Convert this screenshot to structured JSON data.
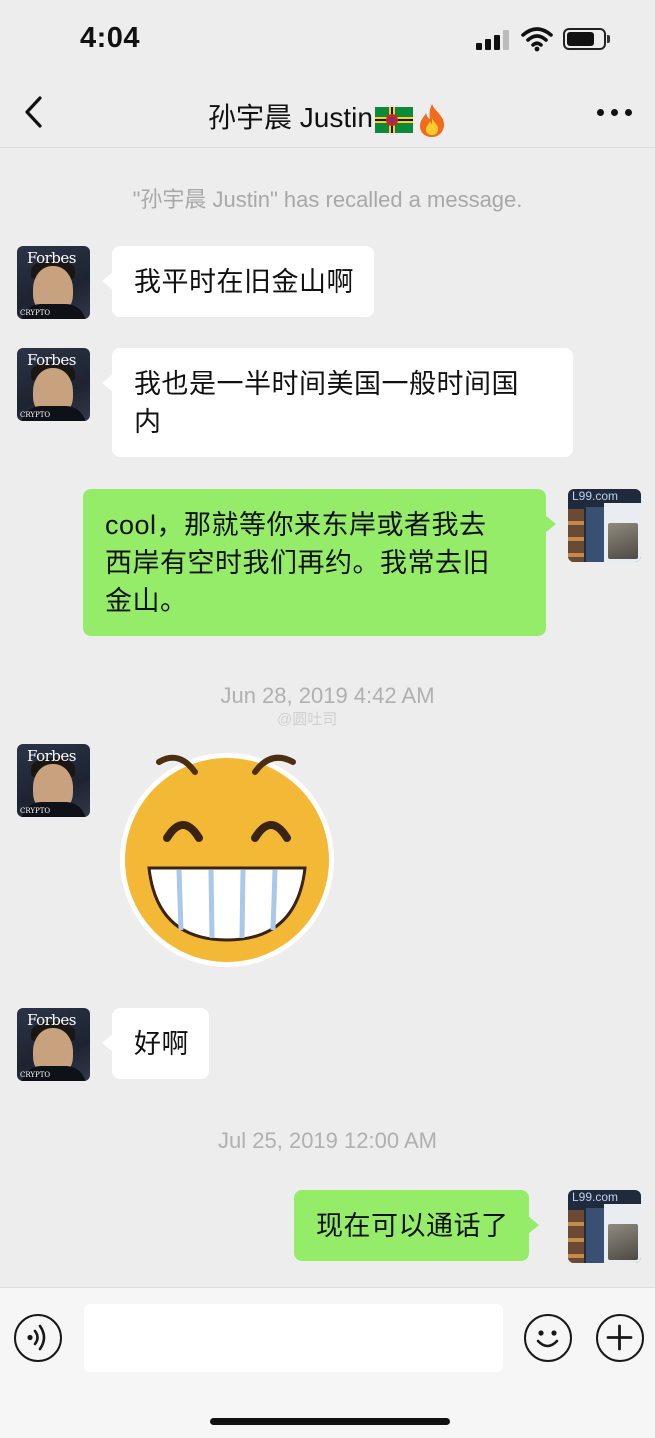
{
  "status_bar": {
    "time": "4:04"
  },
  "nav": {
    "title": "孙宇晨 Justin",
    "flag_icon": "dominica-flag-icon",
    "fire_icon": "fire-emoji-icon"
  },
  "system": {
    "recalled": "\"孙宇晨 Justin\" has recalled a message."
  },
  "messages": [
    {
      "sender": "contact",
      "type": "text",
      "text": "我平时在旧金山啊"
    },
    {
      "sender": "contact",
      "type": "text",
      "line1": "我也是一半时间美国一般时间国",
      "line2": "内"
    },
    {
      "sender": "me",
      "type": "text",
      "line1": "cool，那就等你来东岸或者我去",
      "line2": "西岸有空时我们再约。我常去旧",
      "line3": "金山。"
    },
    {
      "sender": "contact",
      "type": "sticker",
      "sticker": "grinning-face-sticker"
    },
    {
      "sender": "contact",
      "type": "text",
      "text": "好啊"
    },
    {
      "sender": "me",
      "type": "text",
      "text": "现在可以通话了"
    }
  ],
  "timestamps": {
    "t1": "Jun 28, 2019 4:42 AM",
    "t2": "Jul 25, 2019 12:00 AM"
  },
  "avatars": {
    "contact_logo": "Forbes",
    "contact_tag": "CRYPTO",
    "me_watermark": "L99.com"
  },
  "watermark": {
    "text": "@圆吐司"
  },
  "input_bar": {
    "placeholder": ""
  },
  "colors": {
    "background": "#ededed",
    "bubble_out": "#95ec69",
    "bubble_in": "#ffffff"
  }
}
